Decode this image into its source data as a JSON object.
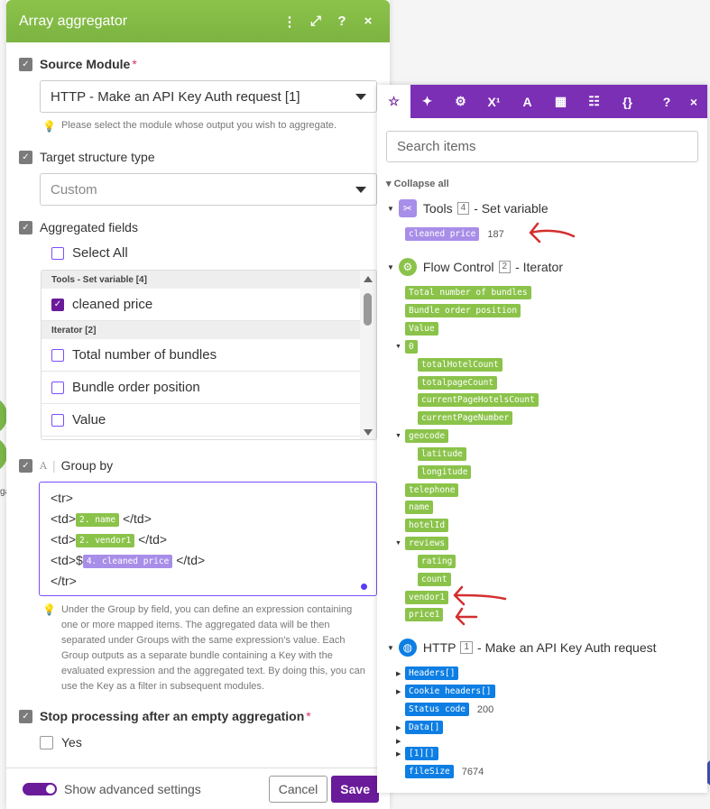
{
  "left": {
    "title": "Array aggregator",
    "source_module": {
      "label": "Source Module",
      "required": "*",
      "value": "HTTP - Make an API Key Auth request [1]",
      "hint": "Please select the module whose output you wish to aggregate."
    },
    "target_structure": {
      "label": "Target structure type",
      "value": "Custom"
    },
    "aggregated_fields": {
      "label": "Aggregated fields",
      "select_all": "Select All",
      "group1": "Tools - Set variable [4]",
      "group1_items": [
        "cleaned price"
      ],
      "group2": "Iterator [2]",
      "group2_items": [
        "Total number of bundles",
        "Bundle order position",
        "Value"
      ]
    },
    "group_by": {
      "icon": "A",
      "label": "Group by",
      "line1": "<tr>",
      "line2_pre": "<td>",
      "line2_tag": "2. name",
      "line2_post": "</td>",
      "line3_pre": "<td>",
      "line3_tag": "2. vendor1",
      "line3_post": "</td>",
      "line4_pre": "<td>$",
      "line4_tag": "4. cleaned price",
      "line4_post": "</td>",
      "line5": "</tr>",
      "hint": "Under the Group by field, you can define an expression containing one or more mapped items. The aggregated data will be then separated under Groups with the same expression's value. Each Group outputs as a separate bundle containing a Key with the evaluated expression and the aggregated text. By doing this, you can use the Key as a filter in subsequent modules."
    },
    "stop_processing": {
      "label": "Stop processing after an empty aggregation",
      "required": "*",
      "option": "Yes"
    },
    "footer": {
      "advanced": "Show advanced settings",
      "cancel": "Cancel",
      "save": "Save"
    }
  },
  "background": {
    "node_label": "ga"
  },
  "right": {
    "tabs": [
      "star-icon",
      "sparkle-icon",
      "gear-icon",
      "superscript-icon",
      "text-icon",
      "calendar-icon",
      "table-icon",
      "braces-icon",
      "help-icon",
      "close-icon"
    ],
    "tab_glyphs": {
      "superscript": "X¹",
      "text": "A",
      "braces": "{}",
      "help": "?",
      "close": "×"
    },
    "search_placeholder": "Search items",
    "collapse_all": "Collapse all",
    "tools": {
      "name": "Tools",
      "num": "4",
      "desc": "- Set variable",
      "item": "cleaned price",
      "item_value": "187"
    },
    "flow": {
      "name": "Flow Control",
      "num": "2",
      "desc": "- Iterator",
      "items": [
        "Total number of bundles",
        "Bundle order position",
        "Value",
        "0",
        "totalHotelCount",
        "totalpageCount",
        "currentPageHotelsCount",
        "currentPageNumber",
        "geocode",
        "latitude",
        "longitude",
        "telephone",
        "name",
        "hotelId",
        "reviews",
        "rating",
        "count",
        "vendor1",
        "price1"
      ]
    },
    "http": {
      "name": "HTTP",
      "num": "1",
      "desc": "- Make an API Key Auth request",
      "items": [
        "Headers[]",
        "Cookie headers[]",
        "Status code",
        "Data[]",
        "[1][]",
        "fileSize"
      ],
      "status_value": "200",
      "filesize_value": "7674"
    }
  },
  "colors": {
    "accent": "#6a1b9a",
    "tab_bar": "#7b2fb5",
    "module_green": "#8bc34a",
    "tag_purple": "#a88ee8",
    "tag_blue": "#0d7ee3",
    "annotation_red": "#d32f2f"
  }
}
